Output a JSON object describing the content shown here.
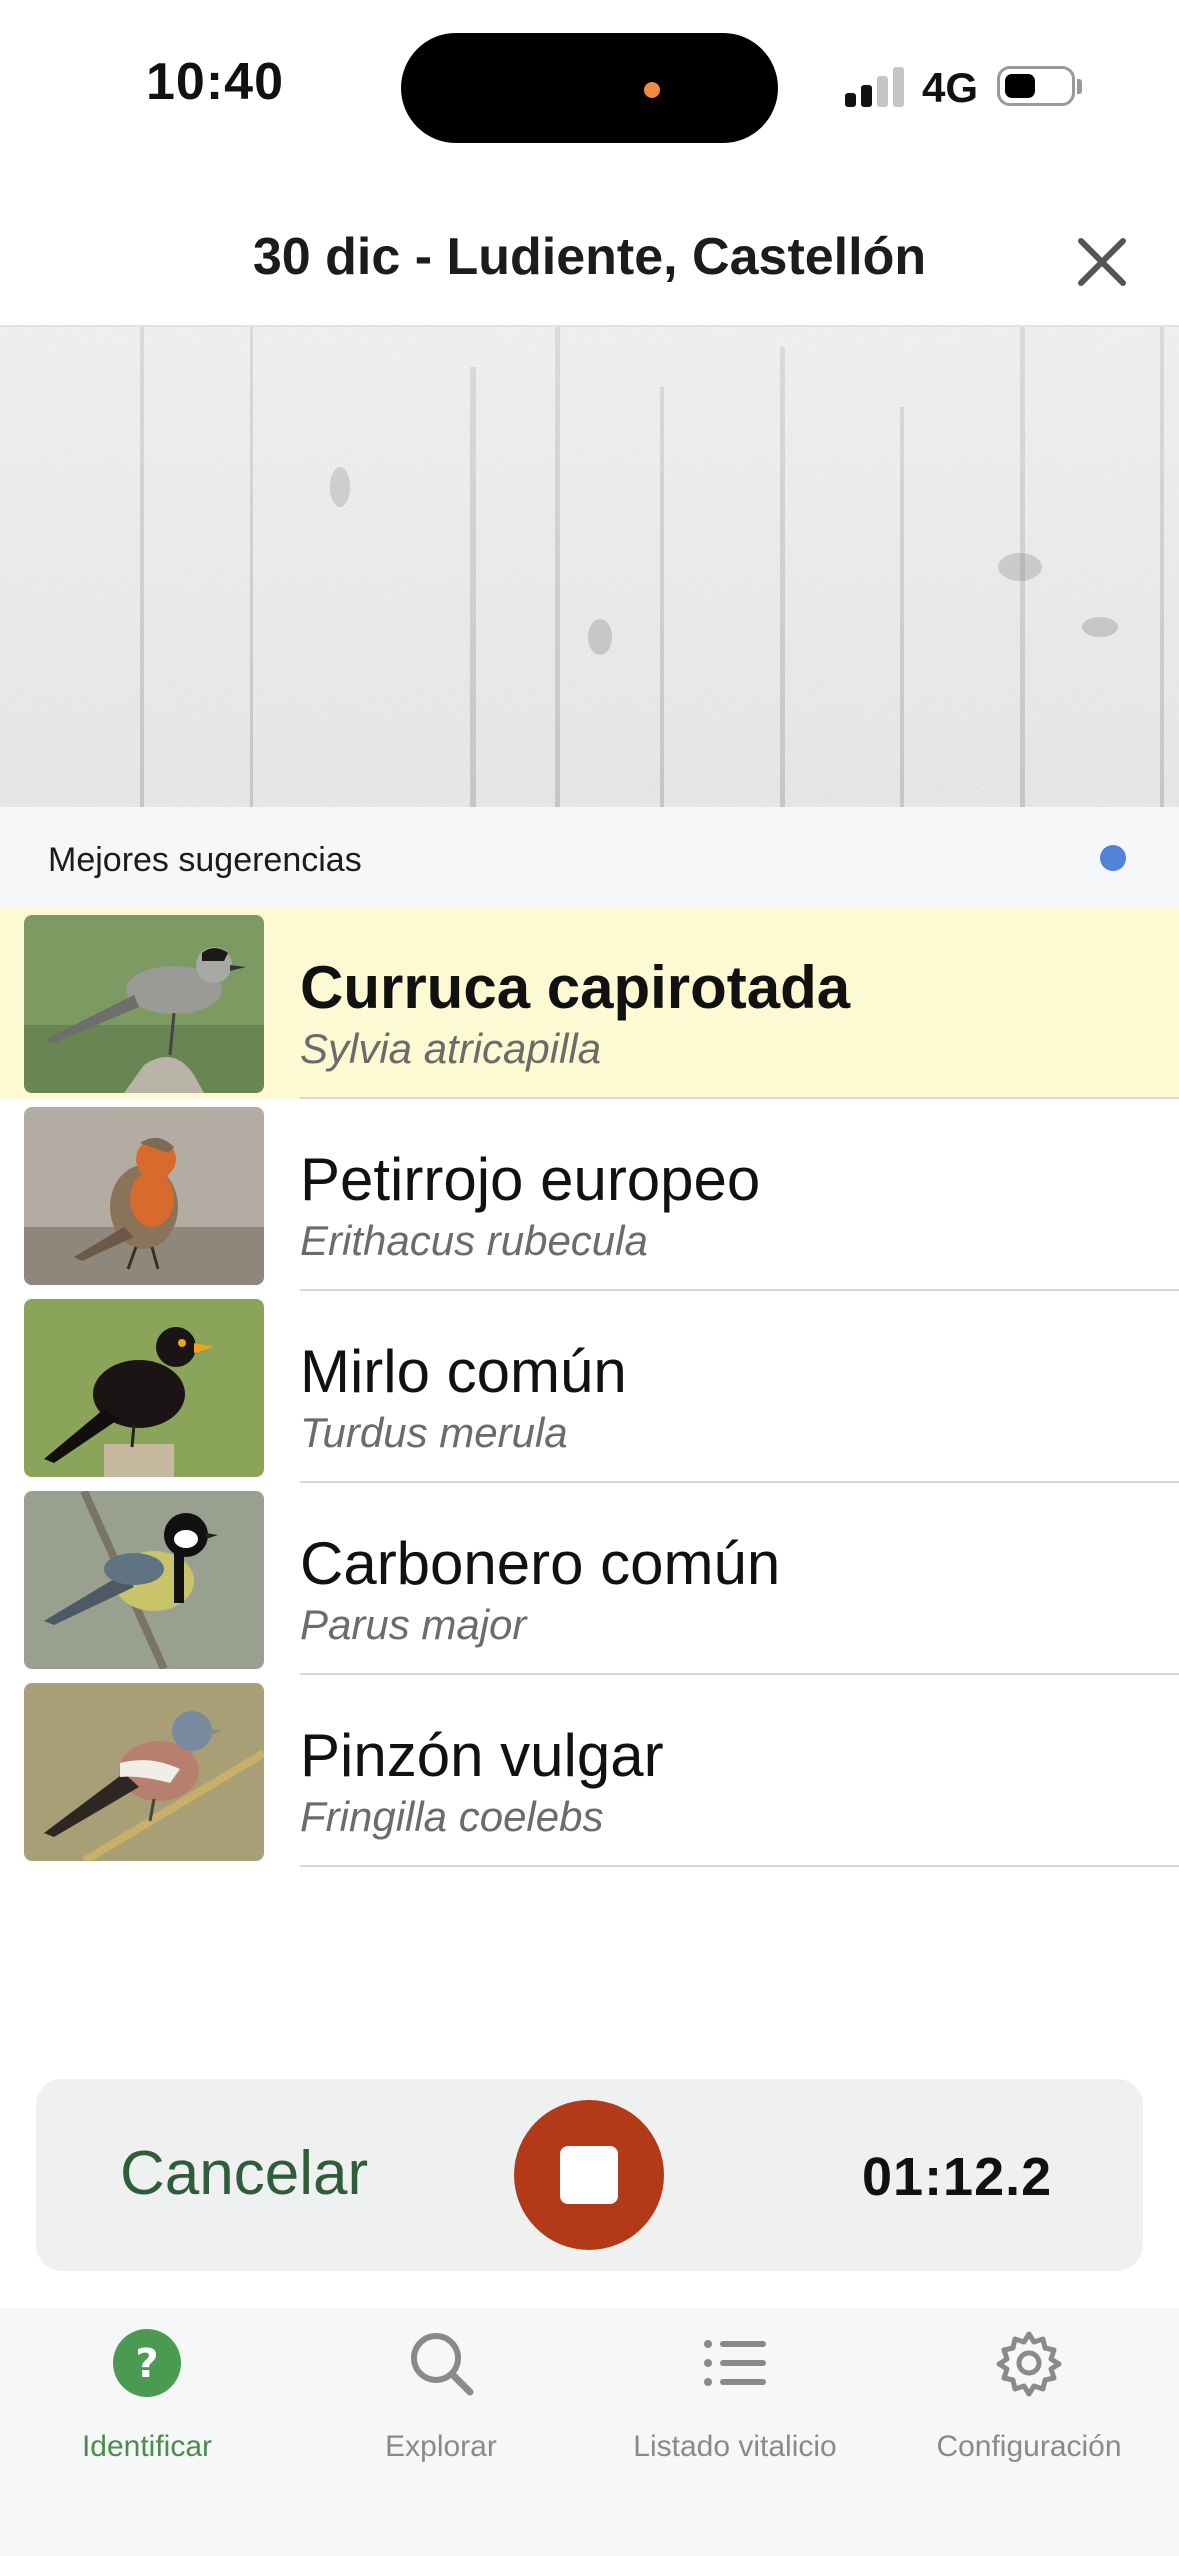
{
  "status_bar": {
    "time": "10:40",
    "network": "4G"
  },
  "header": {
    "title": "30 dic - Ludiente, Castellón"
  },
  "suggestions": {
    "title": "Mejores sugerencias",
    "items": [
      {
        "common": "Curruca capirotada",
        "scientific": "Sylvia atricapilla",
        "highlighted": true
      },
      {
        "common": "Petirrojo europeo",
        "scientific": "Erithacus rubecula",
        "highlighted": false
      },
      {
        "common": "Mirlo común",
        "scientific": "Turdus merula",
        "highlighted": false
      },
      {
        "common": "Carbonero común",
        "scientific": "Parus major",
        "highlighted": false
      },
      {
        "common": "Pinzón vulgar",
        "scientific": "Fringilla coelebs",
        "highlighted": false
      }
    ]
  },
  "recording": {
    "cancel_label": "Cancelar",
    "timer": "01:12.2"
  },
  "tabs": [
    {
      "label": "Identificar",
      "icon": "question-circle-icon",
      "active": true
    },
    {
      "label": "Explorar",
      "icon": "search-icon",
      "active": false
    },
    {
      "label": "Listado vitalicio",
      "icon": "list-icon",
      "active": false
    },
    {
      "label": "Configuración",
      "icon": "gear-icon",
      "active": false
    }
  ],
  "colors": {
    "highlight": "#fdfad3",
    "stop_button": "#b33a18",
    "active_tab": "#4c8c4a",
    "cancel_text": "#2f5d3a",
    "indicator_dot": "#4f84d8"
  }
}
